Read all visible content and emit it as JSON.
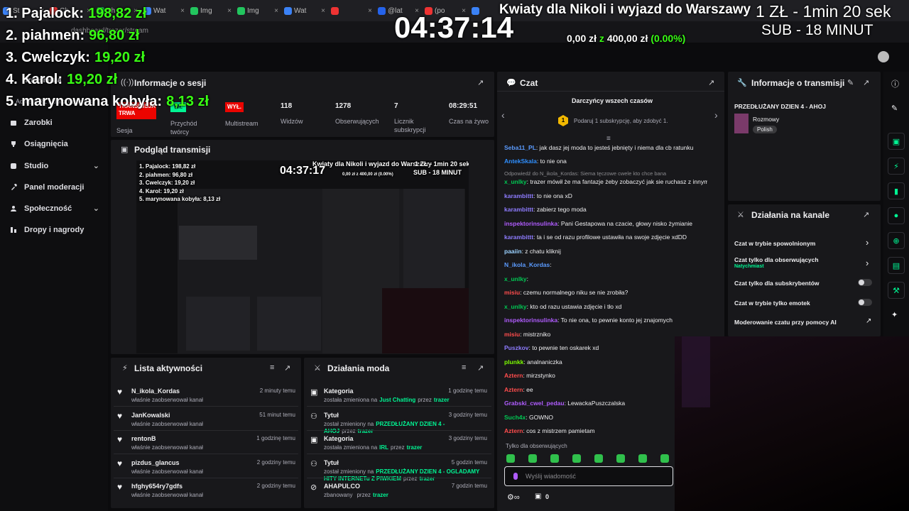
{
  "browser": {
    "tabs": [
      "St",
      "Ch",
      "Sh",
      "Wat",
      "Img",
      "Img",
      "Wat",
      "",
      "@lat",
      "(po",
      ""
    ],
    "address": "dashboard/trazer/stream"
  },
  "overlay": {
    "title": "Kwiaty dla Nikoli i wyjazd do Warszawy",
    "timer": "04:37:14",
    "rate": "1 ZŁ - 1min 20 sek",
    "sub": "SUB - 18 MINUT",
    "goal": "0,00 zł",
    "goal_of": "z",
    "goal_target": "400,00 zł",
    "goal_pct": "(0.00%)",
    "leaderboard": [
      {
        "label": "1. Pajalock:",
        "amount": "198,82 zł"
      },
      {
        "label": "2. piahmen:",
        "amount": "96,80 zł"
      },
      {
        "label": "3. Cwelczyk:",
        "amount": "19,20 zł"
      },
      {
        "label": "4. Karol:",
        "amount": "19,20 zł"
      },
      {
        "label": "5. marynowana kobyła:",
        "amount": "8,13 zł"
      }
    ]
  },
  "nav": {
    "stream_label": "Transmisja",
    "stream_sub": "Adres URL i klucz transmisji",
    "items": [
      "Zarobki",
      "Osiągnięcia",
      "Studio",
      "Panel moderacji",
      "Społeczność",
      "Dropy i nagrody"
    ]
  },
  "session": {
    "title": "Informacje o sesji",
    "live_badge": "TRANSMISJA TRWA",
    "live_label": "Sesja",
    "income_badge": "Wł.",
    "income_label": "Przychód twórcy",
    "multi_badge": "WYŁ.",
    "multi_label": "Multistream",
    "stats": [
      {
        "value": "118",
        "label": "Widzów"
      },
      {
        "value": "1278",
        "label": "Obserwujących"
      },
      {
        "value": "7",
        "label": "Licznik subskrypcji"
      },
      {
        "value": "08:29:51",
        "label": "Czas na żywo"
      }
    ]
  },
  "preview": {
    "title": "Podgląd transmisji",
    "timer": "04:37:17",
    "mini_title": "Kwiaty dla Nikoli i wyjazd do Warszawy",
    "mini_rate": "1 ZŁ - 1min 20 sek",
    "mini_sub": "SUB - 18 MINUT",
    "mini_goal": "0,00 zł z 400,00 zł (0.00%)",
    "mini_board": [
      "1. Pajalock: 198,82 zł",
      "2. piahmen: 96,80 zł",
      "3. Cwelczyk: 19,20 zł",
      "4. Karol: 19,20 zł",
      "5. marynowana kobyła: 8,13 zł"
    ]
  },
  "activity": {
    "title": "Lista aktywności",
    "items": [
      {
        "name": "N_ikola_Kordas",
        "sub": "właśnie zaobserwował kanał",
        "time": "2 minuty temu"
      },
      {
        "name": "JanKowalski",
        "sub": "właśnie zaobserwował kanał",
        "time": "51 minut temu"
      },
      {
        "name": "rentonB",
        "sub": "właśnie zaobserwował kanał",
        "time": "1 godzinę temu"
      },
      {
        "name": "pizdus_glancus",
        "sub": "właśnie zaobserwował kanał",
        "time": "2 godziny temu"
      },
      {
        "name": "hfghy654ry7gdfs",
        "sub": "właśnie zaobserwował kanał",
        "time": "2 godziny temu"
      }
    ]
  },
  "mod": {
    "title": "Działania moda",
    "items": [
      {
        "name": "Kategoria",
        "pre": "została zmieniona na",
        "val": "Just Chatting",
        "by": "przez",
        "who": "trazer",
        "time": "1 godzinę temu"
      },
      {
        "name": "Tytuł",
        "pre": "został zmieniony na",
        "val": "PRZEDŁUŻANY DZIEN 4 - AHOJ",
        "by": "przez",
        "who": "trazer",
        "time": "3 godziny temu"
      },
      {
        "name": "Kategoria",
        "pre": "została zmieniona na",
        "val": "IRL",
        "by": "przez",
        "who": "trazer",
        "time": "3 godziny temu"
      },
      {
        "name": "Tytuł",
        "pre": "został zmieniony na",
        "val": "PRZEDŁUŻANY DZIEN 4 - OGLADAMY HITY INTERNETu Z PIWKIEM",
        "by": "przez",
        "who": "trazer",
        "time": "5 godzin temu"
      },
      {
        "name": "AHAPULCO",
        "pre": "zbanowany",
        "val": "",
        "by": "przez",
        "who": "trazer",
        "time": "7 godzin temu"
      }
    ]
  },
  "chat": {
    "title": "Czat",
    "top_title": "Darczyńcy wszech czasów",
    "top_sub": "Podaruj 1 subskrypcję, aby zdobyć 1.",
    "reply_note": "Odpowiedź do N_ikola_Kordas: Siema tęczowe cwele kto chce bana",
    "messages": [
      {
        "user": "Seba11_PL",
        "color": "#5b9bff",
        "text": ": jak dasz jej moda to jesteś jebnięty i niema dla cb ratunku"
      },
      {
        "user": "AntekSkala",
        "color": "#2f8fff",
        "text": ": to nie ona"
      },
      {
        "user": "x_unlky",
        "color": "#00c853",
        "text": ": trazer mówił że ma fantazje żeby zobaczyć jak sie ruchasz z innym"
      },
      {
        "user": "karambittt",
        "color": "#8e7cff",
        "text": ": to nie ona xD"
      },
      {
        "user": "karambittt",
        "color": "#8e7cff",
        "text": ": zabierz tego moda"
      },
      {
        "user": "inspektorinsulinka",
        "color": "#b05cff",
        "text": ": Pani Gestapowa na czacie, głowy nisko żymianie"
      },
      {
        "user": "karambittt",
        "color": "#8e7cff",
        "text": ": ta i se od razu profilowe ustawiła na swoje zdjęcie xdDD"
      },
      {
        "user": "paaiin",
        "color": "#9ad1ff",
        "text": ": z chatu kliknij"
      },
      {
        "user": "N_ikola_Kordas",
        "color": "#5b9bff",
        "text": ":"
      },
      {
        "user": "x_unlky",
        "color": "#00c853",
        "text": ":"
      },
      {
        "user": "misiu",
        "color": "#ff4d4d",
        "text": ": czemu normalnego niku se nie zrobiła?"
      },
      {
        "user": "x_unlky",
        "color": "#00c853",
        "text": ": kto od razu ustawia zdjęcie i tło xd"
      },
      {
        "user": "inspektorinsulinka",
        "color": "#b05cff",
        "text": ": To nie ona, to pewnie konto jej znajomych"
      },
      {
        "user": "misiu",
        "color": "#ff4d4d",
        "text": ": mistrzniko"
      },
      {
        "user": "Puszkov",
        "color": "#8e7cff",
        "text": ": to pewnie ten oskarek xd"
      },
      {
        "user": "plunkk",
        "color": "#7cfc00",
        "text": ": analnaniczka"
      },
      {
        "user": "Aztern",
        "color": "#ff4d4d",
        "text": ": mirzstynko"
      },
      {
        "user": "Aztern",
        "color": "#ff4d4d",
        "text": ": ee"
      },
      {
        "user": "Grabski_cwel_pedau",
        "color": "#b05cff",
        "text": ": LewackaPuszczalska"
      },
      {
        "user": "Such4x",
        "color": "#00c853",
        "text": ": GOWNO"
      },
      {
        "user": "Aztern",
        "color": "#ff4d4d",
        "text": ": cos z mistrzem pamietam"
      }
    ],
    "followers_only": "Tylko dla obserwujących",
    "input_placeholder": "Wyślij wiadomość",
    "bits": "0"
  },
  "stream_info": {
    "title": "Informacje o transmisji",
    "stream_title": "PRZEDŁUŻANY DZIEN 4 - AHOJ",
    "category": "Rozmowy",
    "tag": "Polish"
  },
  "channel_actions": {
    "title": "Działania na kanale",
    "slow": "Czat w trybie spowolnionym",
    "followers": "Czat tylko dla obserwujących",
    "followers_sub": "Natychmiast",
    "subs": "Czat tylko dla subskrybentów",
    "emotes": "Czat w trybie tylko emotek",
    "ai": "Moderowanie czatu przy pomocy AI"
  },
  "colors": {
    "accent": "#9147ff",
    "green": "#00f593",
    "live": "#eb0400",
    "overlay_green": "#39ff14"
  }
}
